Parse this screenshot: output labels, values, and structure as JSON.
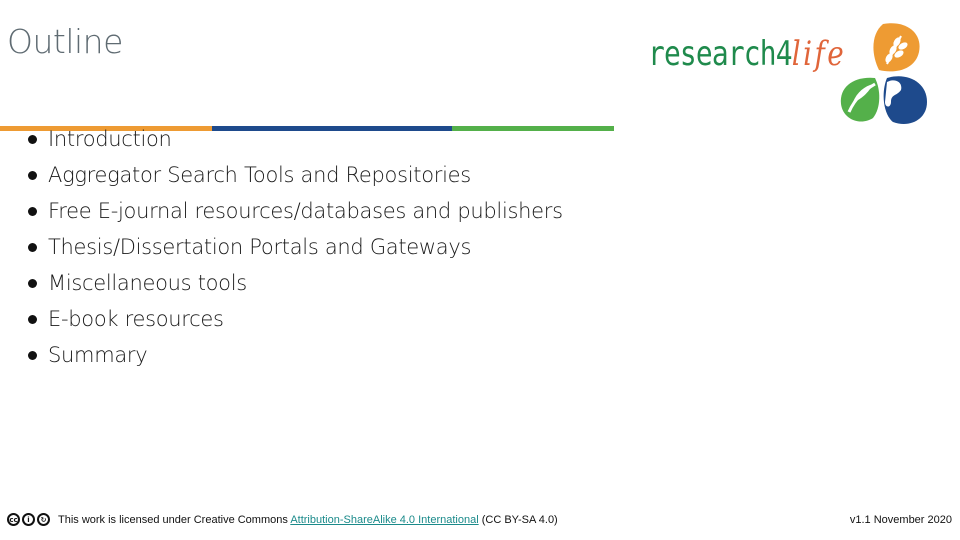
{
  "slide": {
    "title": "Outline",
    "accent_colors": {
      "orange": "#ee9b33",
      "blue": "#1e4a8c",
      "green": "#54b04a"
    },
    "outline_items": [
      {
        "label": "Introduction"
      },
      {
        "label": "Aggregator Search Tools and Repositories"
      },
      {
        "label": "Free E-journal resources/databases and publishers"
      },
      {
        "label": "Thesis/Dissertation Portals and Gateways"
      },
      {
        "label": "Miscellaneous tools"
      },
      {
        "label": "E-book resources"
      },
      {
        "label": "Summary"
      }
    ]
  },
  "logo": {
    "text_main": "research4",
    "text_accent": "life",
    "icons": [
      "wheat-icon",
      "leaf-icon",
      "wave-icon"
    ]
  },
  "footer": {
    "license_icons": [
      "cc-icon",
      "by-icon",
      "sa-icon"
    ],
    "license_prefix": "This work is licensed under Creative Commons ",
    "license_link": "Attribution-ShareAlike 4.0 International",
    "license_suffix": " (CC BY-SA 4.0)",
    "version": "v1.1 November 2020"
  }
}
